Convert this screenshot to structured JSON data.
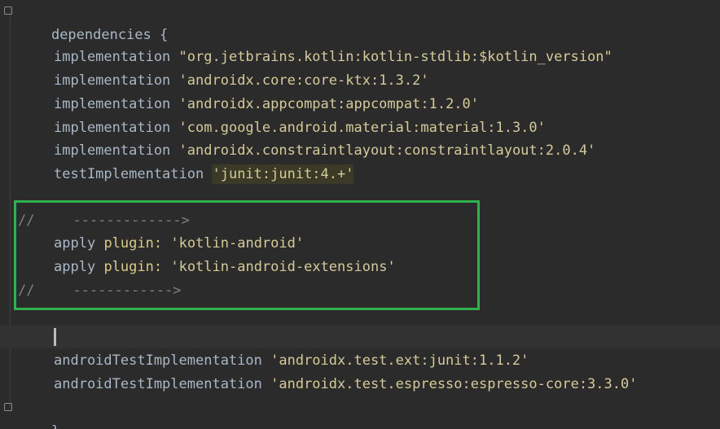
{
  "editor": {
    "opening": "dependencies {",
    "closing": "}",
    "lines": [
      {
        "keyword": "implementation",
        "value": "\"org.jetbrains.kotlin:kotlin-stdlib:$kotlin_version\""
      },
      {
        "keyword": "implementation",
        "value": "'androidx.core:core-ktx:1.3.2'"
      },
      {
        "keyword": "implementation",
        "value": "'androidx.appcompat:appcompat:1.2.0'"
      },
      {
        "keyword": "implementation",
        "value": "'com.google.android.material:material:1.3.0'"
      },
      {
        "keyword": "implementation",
        "value": "'androidx.constraintlayout:constraintlayout:2.0.4'"
      },
      {
        "keyword": "testImplementation",
        "value": "'junit:junit:4.+'"
      }
    ],
    "box": {
      "comment1_slashes": "//",
      "comment1_arrow": "------------->",
      "apply1_apply": "apply",
      "apply1_plugin": "plugin:",
      "apply1_value": "'kotlin-android'",
      "apply2_apply": "apply",
      "apply2_plugin": "plugin:",
      "apply2_value": "'kotlin-android-extensions'",
      "comment2_slashes": "//",
      "comment2_arrow": "------------>"
    },
    "android_lines": [
      {
        "keyword": "androidTestImplementation",
        "value": "'androidx.test.ext:junit:1.1.2'"
      },
      {
        "keyword": "androidTestImplementation",
        "value": "'androidx.test.espresso:espresso-core:3.3.0'"
      }
    ]
  },
  "colors": {
    "background": "#2b2b2b",
    "highlight_box": "#2fb24c",
    "string": "#d5ca9a",
    "comment": "#808080"
  }
}
